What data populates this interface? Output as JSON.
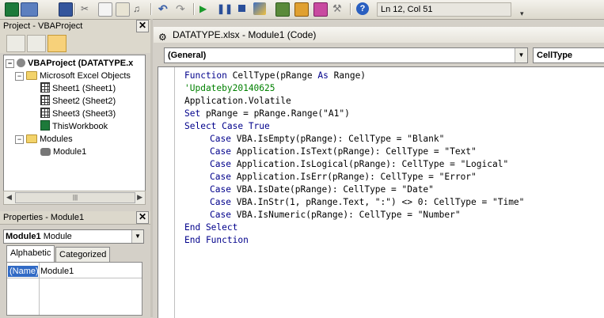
{
  "toolbar": {
    "status": "Ln 12, Col 51",
    "icons": [
      "excel-icon",
      "insert-userform-icon",
      "save-icon",
      "cut-icon",
      "copy-icon",
      "paste-icon",
      "find-icon",
      "undo-icon",
      "redo-icon",
      "run-icon",
      "break-icon",
      "reset-icon",
      "design-mode-icon",
      "project-explorer-icon",
      "properties-icon",
      "object-browser-icon",
      "toolbox-icon",
      "help-icon"
    ]
  },
  "project_pane": {
    "title": "Project - VBAProject",
    "close": "✕",
    "tree": {
      "root": "VBAProject (DATATYPE.x",
      "excel_objects": "Microsoft Excel Objects",
      "sheets": [
        "Sheet1 (Sheet1)",
        "Sheet2 (Sheet2)",
        "Sheet3 (Sheet3)"
      ],
      "workbook": "ThisWorkbook",
      "modules_folder": "Modules",
      "module": "Module1"
    }
  },
  "properties_pane": {
    "title": "Properties - Module1",
    "close": "✕",
    "object_name": "Module1",
    "object_type": "Module",
    "tabs": [
      "Alphabetic",
      "Categorized"
    ],
    "property_name": "(Name)",
    "property_value": "Module1"
  },
  "code_window": {
    "title": "DATATYPE.xlsx - Module1 (Code)",
    "object_combo": "(General)",
    "proc_combo": "CellType",
    "lines": [
      {
        "indent": 0,
        "parts": [
          [
            "kw",
            "Function "
          ],
          [
            "",
            "CellType(pRange "
          ],
          [
            "kw",
            "As "
          ],
          [
            "",
            "Range)"
          ]
        ]
      },
      {
        "indent": 0,
        "parts": [
          [
            "cm",
            "'Updateby20140625"
          ]
        ]
      },
      {
        "indent": 0,
        "parts": [
          [
            "",
            "Application.Volatile"
          ]
        ]
      },
      {
        "indent": 0,
        "parts": [
          [
            "kw",
            "Set "
          ],
          [
            "",
            "pRange = pRange.Range(\"A1\")"
          ]
        ]
      },
      {
        "indent": 0,
        "parts": [
          [
            "kw",
            "Select Case True"
          ]
        ]
      },
      {
        "indent": 1,
        "parts": [
          [
            "kw",
            "Case "
          ],
          [
            "",
            "VBA.IsEmpty(pRange): CellType = \"Blank\""
          ]
        ]
      },
      {
        "indent": 1,
        "parts": [
          [
            "kw",
            "Case "
          ],
          [
            "",
            "Application.IsText(pRange): CellType = \"Text\""
          ]
        ]
      },
      {
        "indent": 1,
        "parts": [
          [
            "kw",
            "Case "
          ],
          [
            "",
            "Application.IsLogical(pRange): CellType = \"Logical\""
          ]
        ]
      },
      {
        "indent": 1,
        "parts": [
          [
            "kw",
            "Case "
          ],
          [
            "",
            "Application.IsErr(pRange): CellType = \"Error\""
          ]
        ]
      },
      {
        "indent": 1,
        "parts": [
          [
            "kw",
            "Case "
          ],
          [
            "",
            "VBA.IsDate(pRange): CellType = \"Date\""
          ]
        ]
      },
      {
        "indent": 1,
        "parts": [
          [
            "kw",
            "Case "
          ],
          [
            "",
            "VBA.InStr(1, pRange.Text, \":\") <> 0: CellType = \"Time\""
          ]
        ]
      },
      {
        "indent": 1,
        "parts": [
          [
            "kw",
            "Case "
          ],
          [
            "",
            "VBA.IsNumeric(pRange): CellType = \"Number\""
          ]
        ]
      },
      {
        "indent": 0,
        "parts": [
          [
            "kw",
            "End Select"
          ]
        ]
      },
      {
        "indent": 0,
        "parts": [
          [
            "kw",
            "End Function"
          ]
        ]
      }
    ]
  }
}
